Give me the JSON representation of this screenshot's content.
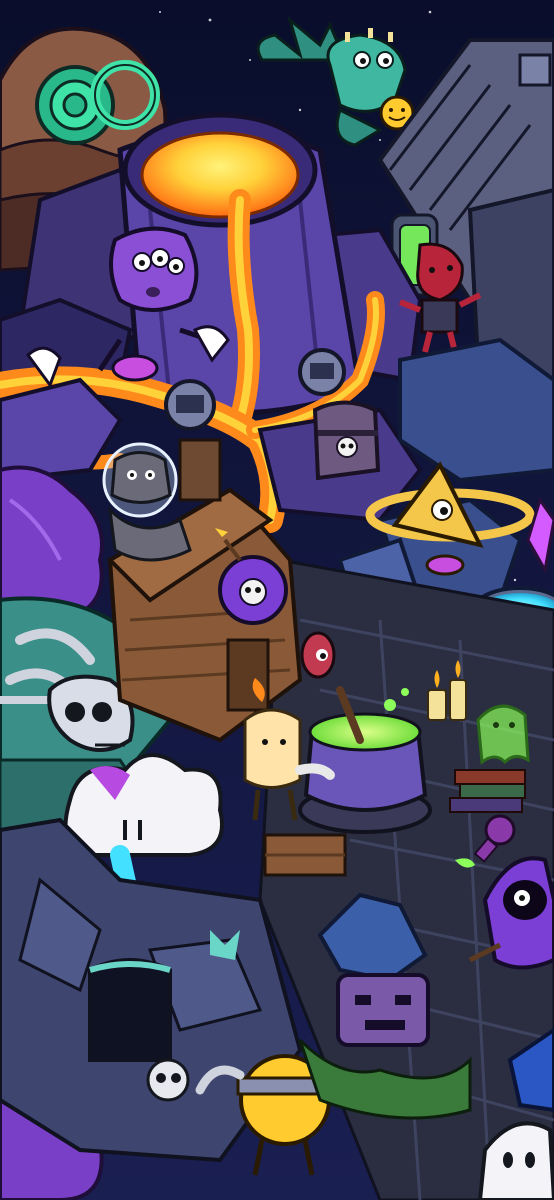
{
  "scene": {
    "title": "",
    "theme": "spooky cartoon island illustration",
    "palette": {
      "night_sky": "#0c1030",
      "lava_orange": "#ff8a1c",
      "lava_yellow": "#ffd23a",
      "rock_purple": "#4a3a8c",
      "rock_blue": "#3a4f8e",
      "grass_teal": "#3a8f88",
      "foliage_purple": "#7a3fc7",
      "slime_green": "#8cff5a",
      "water_cyan": "#43e0ff"
    },
    "characters": [
      {
        "name": "dragon",
        "icon": "green-dragon-icon"
      },
      {
        "name": "three-eyed-monster",
        "icon": "purple-monster-icon"
      },
      {
        "name": "red-imp",
        "icon": "red-imp-icon"
      },
      {
        "name": "astronaut-cat",
        "icon": "cat-icon"
      },
      {
        "name": "triangle-creature",
        "icon": "triangle-creature-icon"
      },
      {
        "name": "cloud-creature",
        "icon": "cloud-icon"
      },
      {
        "name": "candle-kid",
        "icon": "candle-icon"
      },
      {
        "name": "green-ghost",
        "icon": "ghost-icon"
      },
      {
        "name": "hooded-figure",
        "icon": "hooded-figure-icon"
      },
      {
        "name": "white-ghost",
        "icon": "ghost-icon"
      },
      {
        "name": "yellow-ball",
        "icon": "ball-icon"
      }
    ]
  }
}
